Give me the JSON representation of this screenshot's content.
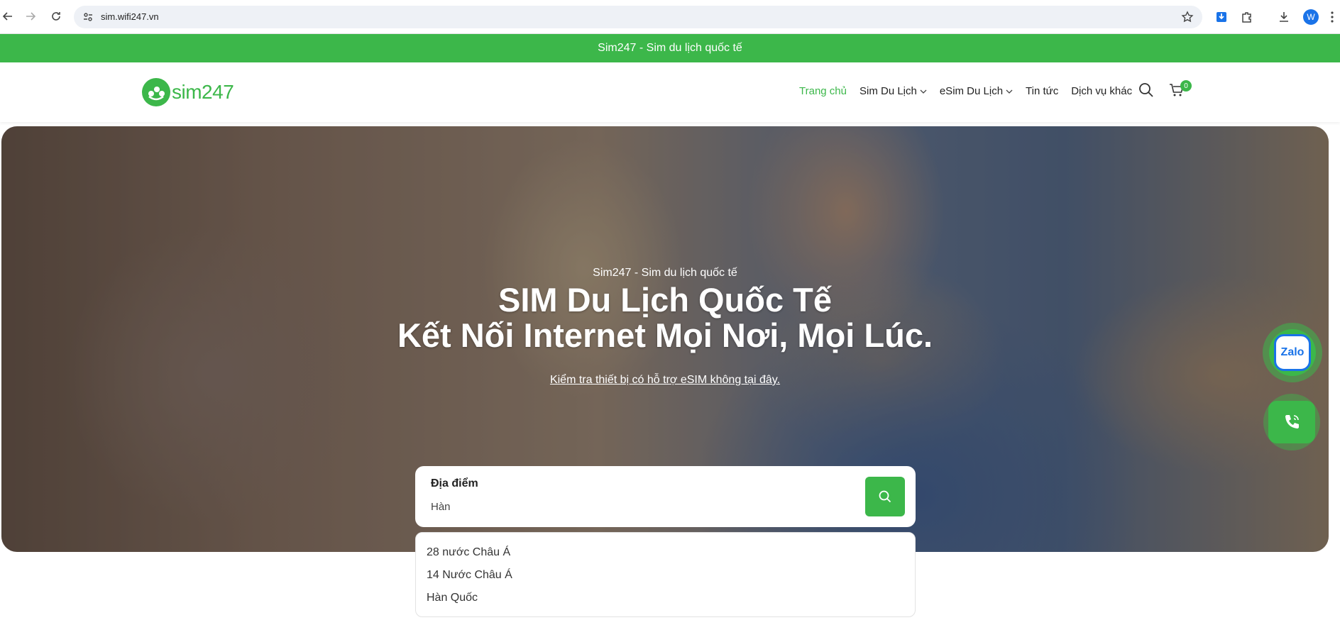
{
  "browser": {
    "url": "sim.wifi247.vn",
    "profile_initial": "W"
  },
  "topbar": {
    "text": "Sim247 - Sim du lịch quốc tế"
  },
  "header": {
    "logo_text": "sim247",
    "menu": [
      {
        "label": "Trang chủ",
        "active": true,
        "has_dropdown": false
      },
      {
        "label": "Sim Du Lịch",
        "active": false,
        "has_dropdown": true
      },
      {
        "label": "eSim Du Lịch",
        "active": false,
        "has_dropdown": true
      },
      {
        "label": "Tin tức",
        "active": false,
        "has_dropdown": false
      },
      {
        "label": "Dịch vụ khác",
        "active": false,
        "has_dropdown": false
      }
    ],
    "cart_count": "0"
  },
  "hero": {
    "subtitle": "Sim247 - Sim du lịch quốc tế",
    "title_line1": "SIM Du Lịch Quốc Tế",
    "title_line2": "Kết Nối Internet Mọi Nơi, Mọi Lúc.",
    "esim_link": "Kiểm tra thiết bị có hỗ trợ eSIM không tại đây."
  },
  "search": {
    "label": "Địa điểm",
    "value": "Hàn",
    "suggestions": [
      "28 nước Châu Á",
      "14 Nước Châu Á",
      "Hàn Quốc"
    ]
  },
  "floating": {
    "zalo_label": "Zalo"
  },
  "colors": {
    "brand_green": "#3cb74a",
    "zalo_blue": "#1a73e8"
  }
}
